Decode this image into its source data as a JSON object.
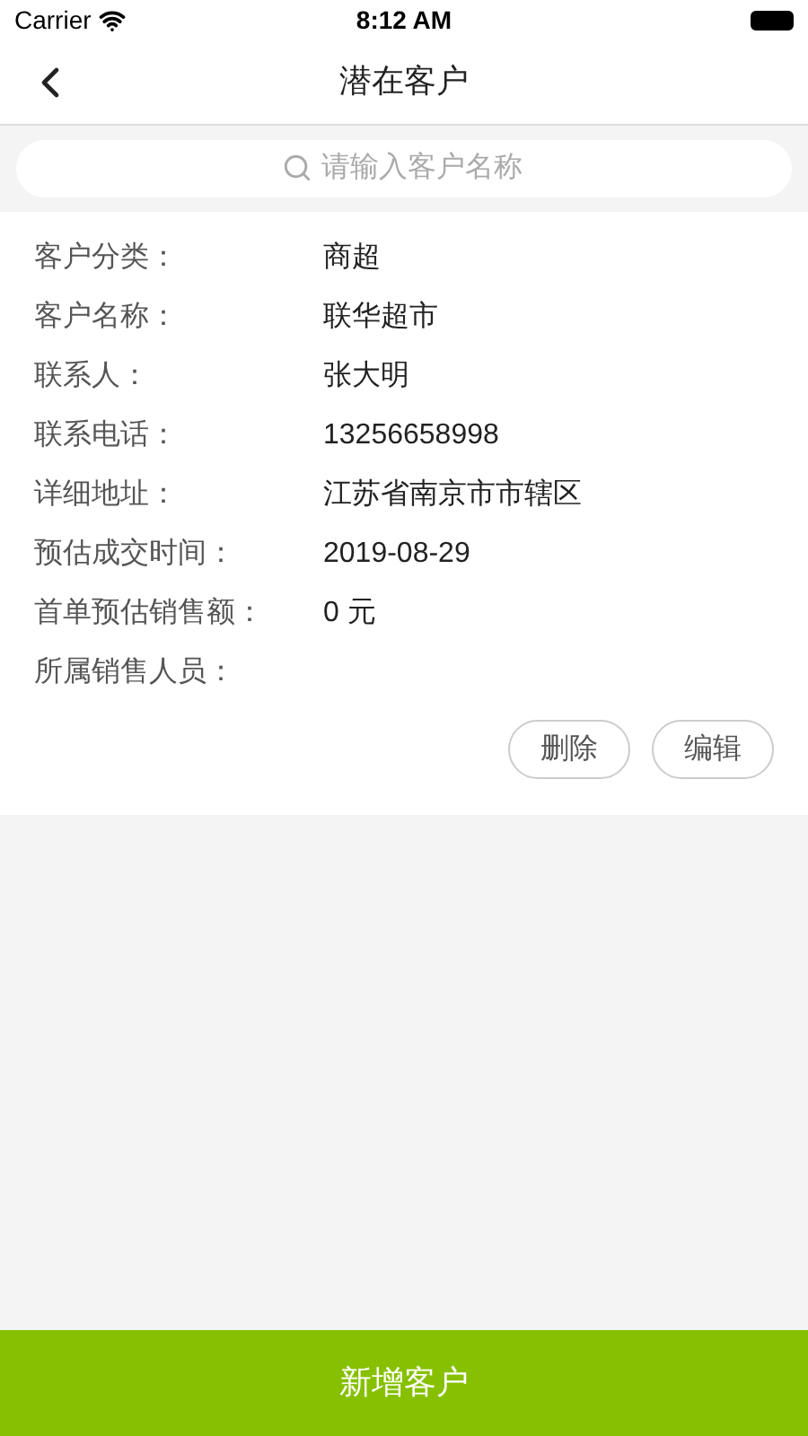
{
  "status_bar": {
    "carrier": "Carrier",
    "time": "8:12 AM"
  },
  "nav": {
    "title": "潜在客户"
  },
  "search": {
    "placeholder": "请输入客户名称"
  },
  "fields": [
    {
      "label": "客户分类：",
      "value": "商超"
    },
    {
      "label": "客户名称：",
      "value": "联华超市"
    },
    {
      "label": "联系人：",
      "value": "张大明"
    },
    {
      "label": "联系电话：",
      "value": "13256658998"
    },
    {
      "label": "详细地址：",
      "value": "江苏省南京市市辖区"
    },
    {
      "label": "预估成交时间：",
      "value": "2019-08-29"
    },
    {
      "label": "首单预估销售额：",
      "value": "0 元"
    },
    {
      "label": "所属销售人员："
    }
  ],
  "actions": [
    "删除",
    "编辑"
  ],
  "bottom_button": "新增客户"
}
